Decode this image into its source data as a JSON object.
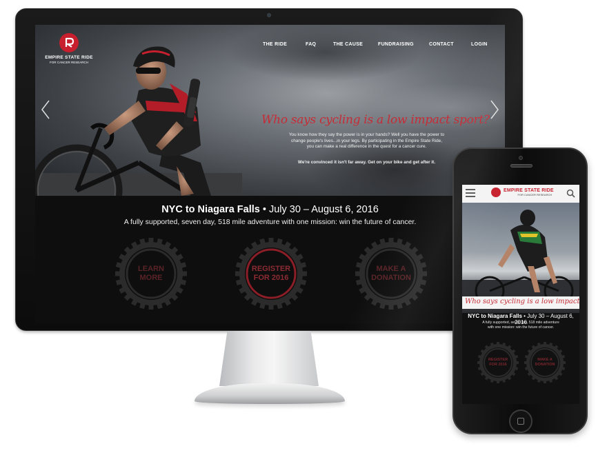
{
  "site": {
    "brand_title": "EMPIRE STATE RIDE",
    "brand_subtitle": "FOR CANCER RESEARCH"
  },
  "nav": {
    "items": [
      {
        "label": "THE RIDE"
      },
      {
        "label": "FAQ"
      },
      {
        "label": "THE CAUSE"
      },
      {
        "label": "FUNDRAISING"
      },
      {
        "label": "CONTACT"
      },
      {
        "label": "LOGIN"
      }
    ]
  },
  "hero": {
    "headline": "Who says cycling is a low impact sport?",
    "body_line1": "You know how they say the power is in your hands? Well you have the power to",
    "body_line2": "change people's lives...in your legs. By participating in the Empire State Ride,",
    "body_line3": "you can make a real difference in the quest for a cancer cure.",
    "body_bold": "We're convinced it isn't far away. Get on your bike and get after it."
  },
  "event": {
    "title_bold": "NYC to Niagara Falls",
    "title_rest": " • July 30 – August 6, 2016",
    "subtitle": "A fully supported, seven day, 518 mile adventure with one mission: win the future of cancer."
  },
  "ctas": {
    "learn_line1": "LEARN",
    "learn_line2": "MORE",
    "register_line1": "REGISTER",
    "register_line2": "FOR 2016",
    "donate_line1": "MAKE A",
    "donate_line2": "DONATION"
  },
  "mobile": {
    "brand_title": "EMPIRE STATE RIDE",
    "brand_subtitle": "FOR CANCER RESEARCH",
    "headline": "Who says cycling is a low impact sport?",
    "event_title_bold": "NYC to Niagara Falls",
    "event_title_rest": " • July 30 – August 6, 2016",
    "event_sub_line1": "A fully supported, seven day, 518 mile adventure",
    "event_sub_line2": "with one mission: win the future of cancer.",
    "register_line1": "REGISTER",
    "register_line2": "FOR 2016",
    "donate_line1": "MAKE A",
    "donate_line2": "DONATION"
  },
  "colors": {
    "brand_red": "#c71f2d",
    "headline_red": "#c62b36",
    "dark_gear": "#2e2e2e",
    "inactive_text": "#8a2a31"
  }
}
